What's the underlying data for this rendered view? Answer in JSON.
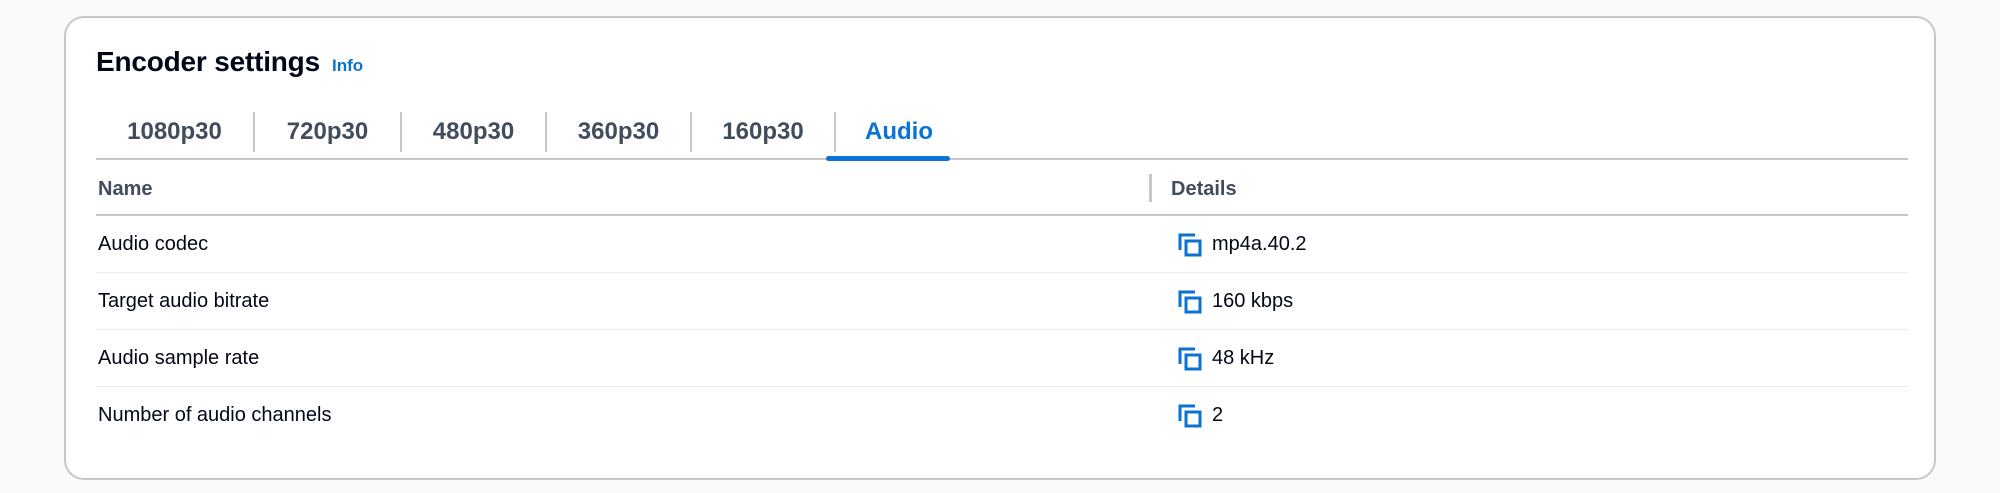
{
  "header": {
    "title": "Encoder settings",
    "info_label": "Info"
  },
  "tabs": [
    {
      "label": "1080p30",
      "active": false
    },
    {
      "label": "720p30",
      "active": false
    },
    {
      "label": "480p30",
      "active": false
    },
    {
      "label": "360p30",
      "active": false
    },
    {
      "label": "160p30",
      "active": false
    },
    {
      "label": "Audio",
      "active": true
    }
  ],
  "table": {
    "columns": [
      "Name",
      "Details"
    ],
    "rows": [
      {
        "name": "Audio codec",
        "detail": "mp4a.40.2"
      },
      {
        "name": "Target audio bitrate",
        "detail": "160 kbps"
      },
      {
        "name": "Audio sample rate",
        "detail": "48 kHz"
      },
      {
        "name": "Number of audio channels",
        "detail": "2"
      }
    ]
  },
  "icons": {
    "copy": "copy-icon"
  },
  "colors": {
    "accent": "#0972d3",
    "text": "#000716",
    "muted": "#414d5c",
    "border": "#c6c6cd"
  }
}
